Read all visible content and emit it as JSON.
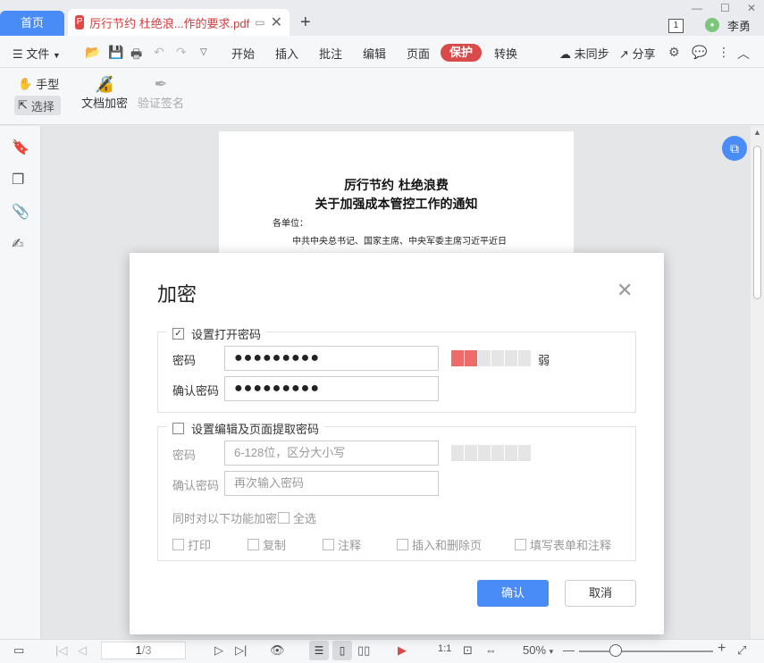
{
  "titlebar": {
    "home_tab": "首页",
    "doc_tab": "厉行节约 杜绝浪...作的要求.pdf",
    "pdf_badge": "P",
    "new_tab": "+",
    "window_count": "1",
    "user_avatar": "李勇",
    "user_name": "李勇"
  },
  "menubar": {
    "file": "文件",
    "items": [
      "开始",
      "插入",
      "批注",
      "编辑",
      "页面"
    ],
    "active": "保护",
    "convert": "转换",
    "sync": "未同步",
    "share": "分享"
  },
  "ribbon": {
    "hand": "手型",
    "select": "选择",
    "encrypt": "文档加密",
    "verify": "验证签名"
  },
  "document": {
    "title1": "厉行节约   杜绝浪费",
    "title2": "关于加强成本管控工作的通知",
    "line1": "各单位：",
    "line2": "中共中央总书记、国家主席、中央军委主席习近平近日"
  },
  "statusbar": {
    "page_current": "1",
    "page_total": "/3",
    "zoom": "50%"
  },
  "dialog": {
    "title": "加密",
    "open_group": {
      "label": "设置打开密码",
      "checked": true,
      "password_label": "密码",
      "password_value": "●●●●●●●●●",
      "confirm_label": "确认密码",
      "confirm_value": "●●●●●●●●●",
      "strength_text": "弱",
      "strength_level": 2,
      "strength_max": 6
    },
    "edit_group": {
      "label": "设置编辑及页面提取密码",
      "checked": false,
      "password_label": "密码",
      "password_placeholder": "6-128位，区分大小写",
      "confirm_label": "确认密码",
      "confirm_placeholder": "再次输入密码",
      "also_encrypt": "同时对以下功能加密",
      "select_all": "全选",
      "options": [
        "打印",
        "复制",
        "注释",
        "插入和删除页",
        "填写表单和注释"
      ]
    },
    "ok": "确认",
    "cancel": "取消"
  },
  "colors": {
    "accent": "#4a8cf7",
    "protect_tab": "#d94b4b",
    "strength_weak": "#ee6b6b"
  }
}
